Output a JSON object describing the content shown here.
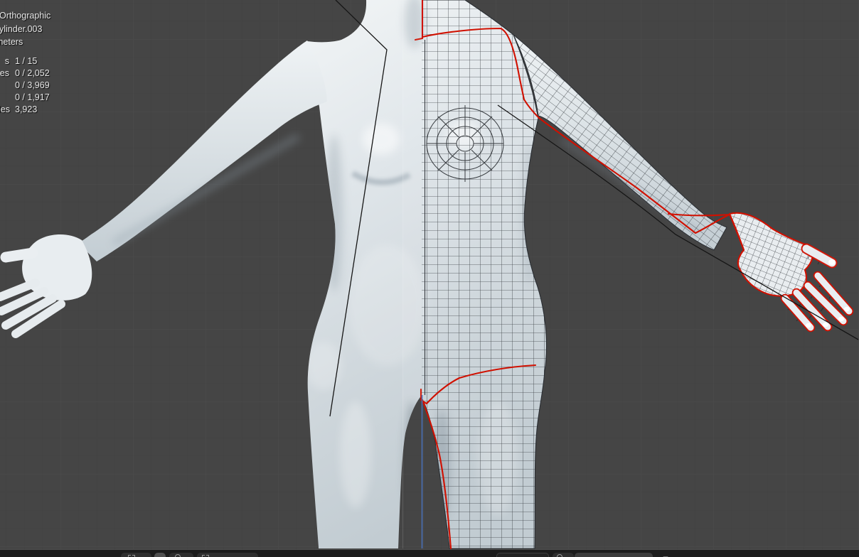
{
  "viewport": {
    "hud": {
      "view_label": "Orthographic",
      "object_label": "ylinder.003",
      "unit_label": "meters",
      "stats": [
        {
          "label": "s",
          "value": "1 / 15"
        },
        {
          "label": "es",
          "value": "0 / 2,052"
        },
        {
          "label": "",
          "value": "0 / 3,969"
        },
        {
          "label": "",
          "value": "0 / 1,917"
        },
        {
          "label": "les",
          "value": "3,923"
        }
      ]
    },
    "colors": {
      "background": "#454545",
      "grid_minor": "#3e3e3e",
      "grid_major": "#505050",
      "model_light": "#eef2f4",
      "model_shade": "#bfc9cf",
      "wireframe": "#262a2e",
      "seam_red": "#d01000",
      "axis_blue": "#4a6fb5",
      "bone_black": "#141414"
    },
    "content": "split-view female body mesh: left half smooth shaded, right half edit-mode wireframe with red UV seams, black bone lines, blue axis line"
  },
  "bottom_bar": {
    "buttons": [
      {
        "name": "editor-button-1",
        "icon": "corner-brackets-icon"
      },
      {
        "name": "editor-button-2",
        "icon": "active-toggle"
      },
      {
        "name": "editor-button-3",
        "icon": "circle-icon"
      },
      {
        "name": "editor-button-4",
        "icon": "corner-brackets-icon"
      },
      {
        "name": "editor-button-5",
        "icon": "outline-pill"
      },
      {
        "name": "editor-button-6",
        "icon": "circle-icon"
      },
      {
        "name": "editor-button-7",
        "icon": "segment"
      },
      {
        "name": "editor-button-8",
        "icon": "caret-icon"
      }
    ]
  }
}
